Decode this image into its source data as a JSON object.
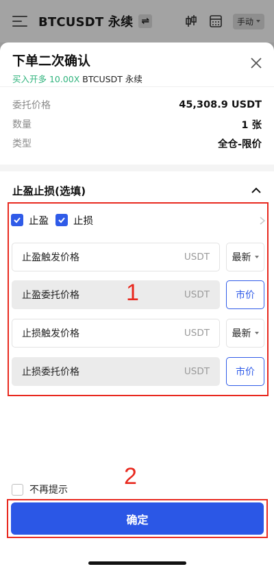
{
  "topbar": {
    "pair": "BTCUSDT 永续",
    "swap_glyph": "⇌",
    "mode": "手动"
  },
  "modal": {
    "title": "下单二次确认",
    "subtitle_side": "买入开多 10.00X",
    "subtitle_pair": " BTCUSDT 永续",
    "info": [
      {
        "key": "委托价格",
        "value": "45,308.9 USDT"
      },
      {
        "key": "数量",
        "value": "1 张"
      },
      {
        "key": "类型",
        "value": "全仓-限价"
      }
    ],
    "tpsl": {
      "title": "止盈止损(选填)",
      "tp_label": "止盈",
      "sl_label": "止损",
      "tp_checked": true,
      "sl_checked": true,
      "fields": [
        {
          "label": "止盈触发价格",
          "unit": "USDT",
          "side_label": "最新",
          "side_type": "select"
        },
        {
          "label": "止盈委托价格",
          "unit": "USDT",
          "side_label": "市价",
          "side_type": "button"
        },
        {
          "label": "止损触发价格",
          "unit": "USDT",
          "side_label": "最新",
          "side_type": "select"
        },
        {
          "label": "止损委托价格",
          "unit": "USDT",
          "side_label": "市价",
          "side_type": "button"
        }
      ]
    },
    "no_remind": "不再提示",
    "confirm": "确定"
  },
  "annotations": {
    "box1": "1",
    "box2": "2"
  },
  "colors": {
    "accent_blue": "#2f5be8",
    "buy_green": "#2fb37c",
    "annotation_red": "#e8281e"
  }
}
